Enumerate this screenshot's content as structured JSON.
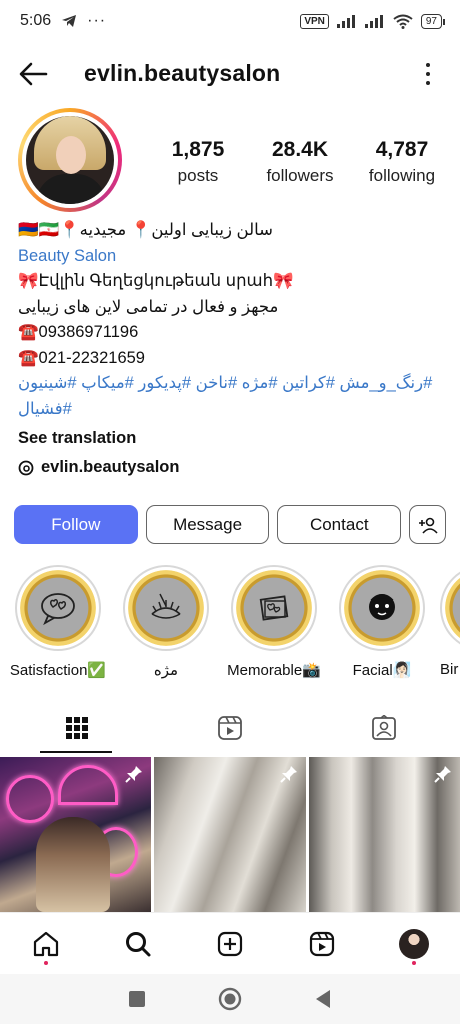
{
  "status_bar": {
    "time": "5:06",
    "vpn_label": "VPN",
    "battery": "97"
  },
  "header": {
    "username": "evlin.beautysalon"
  },
  "stats": [
    {
      "value": "1,875",
      "label": "posts"
    },
    {
      "value": "28.4K",
      "label": "followers"
    },
    {
      "value": "4,787",
      "label": "following"
    }
  ],
  "bio": {
    "name_line": "🇦🇲🇮🇷📍سالن زیبایی اولین📍 مجیدیه",
    "category": "Beauty Salon",
    "armenian_line": "🎀Էվլին Գեղեցկութեան սրահ🎀",
    "persian_line": "مجهز و فعال در تمامی لاین های زیبایی",
    "phone1": "☎️09386971196",
    "phone2": "☎️021-22321659",
    "hashtags_line1": "#رنگ_و_مش #کراتین #مژه #ناخن #پدیکور #میکاپ #شینیون",
    "hashtags_line2": "#فشیال",
    "see_translation": "See translation",
    "threads_handle": "evlin.beautysalon"
  },
  "actions": {
    "follow": "Follow",
    "message": "Message",
    "contact": "Contact"
  },
  "highlights": [
    {
      "label": "Satisfaction✅",
      "icon": "hearts-chat-icon"
    },
    {
      "label": "مژه",
      "icon": "eyelash-icon"
    },
    {
      "label": "Memorable📸",
      "icon": "photo-hearts-icon"
    },
    {
      "label": "Facial🧖🏻‍♀️",
      "icon": "face-mask-icon"
    },
    {
      "label": "Bir",
      "icon": "partial-highlight"
    }
  ],
  "tabs": [
    "grid-icon",
    "reels-icon",
    "tagged-icon"
  ],
  "colors": {
    "follow_button": "#5a72f4",
    "link_blue": "#3a78c8",
    "notification_dot": "#e0245e"
  }
}
